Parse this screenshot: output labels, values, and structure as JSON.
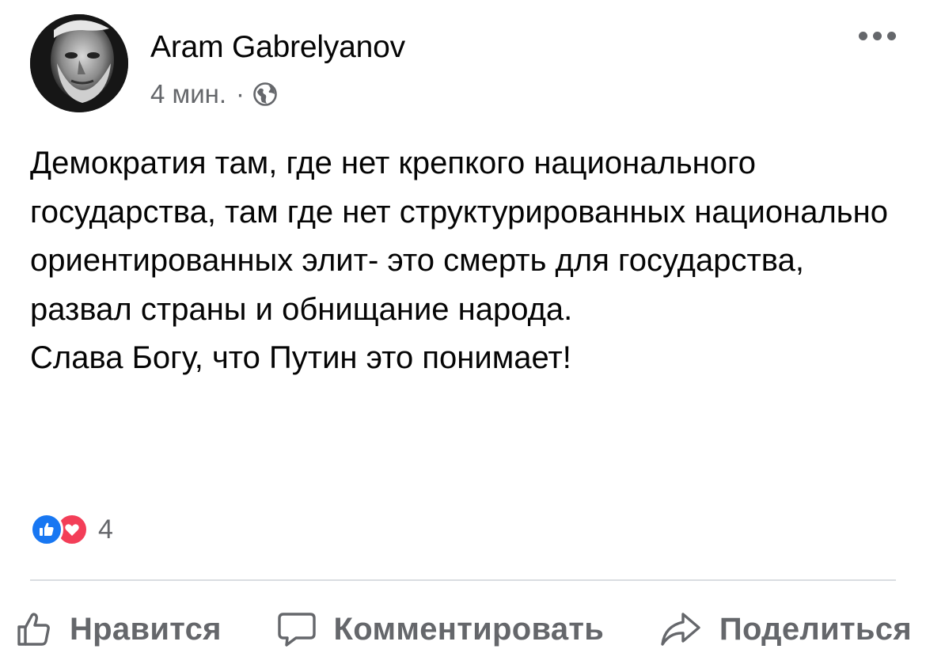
{
  "post": {
    "author": "Aram Gabrelyanov",
    "time": "4 мин.",
    "separator": "·",
    "privacy_icon": "globe-icon",
    "text_paragraphs": [
      "Демократия там, где нет крепкого национального государства, там где нет структурированных национально ориентированных элит- это смерть для государства, развал страны и обнищание народа.",
      "Слава Богу, что Путин это понимает!"
    ],
    "reaction_icons": [
      "like-icon",
      "love-icon"
    ],
    "reaction_count": "4"
  },
  "actions": {
    "like_label": "Нравится",
    "comment_label": "Комментировать",
    "share_label": "Поделиться"
  },
  "colors": {
    "text": "#050505",
    "secondary": "#65676b",
    "like_blue": "#1877f2",
    "love_red": "#f33e58",
    "divider": "#dadde1"
  }
}
